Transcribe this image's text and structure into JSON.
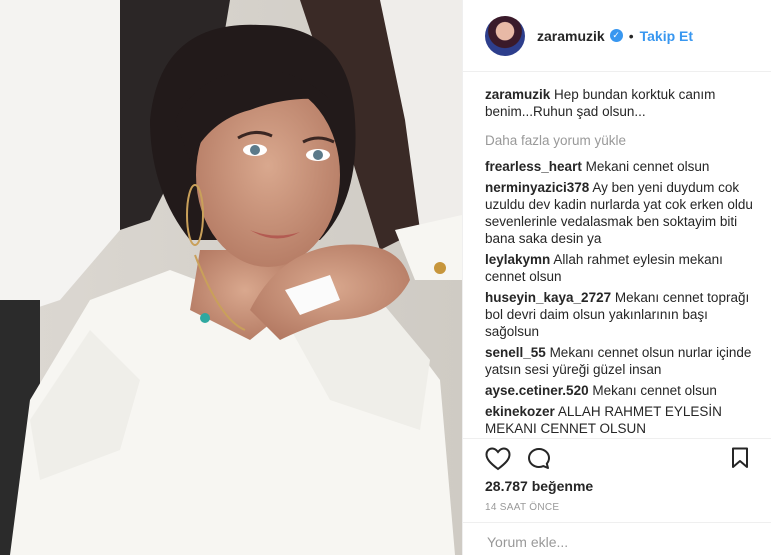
{
  "post": {
    "username": "zaramuzik",
    "verified_mark": "✓",
    "separator": "•",
    "follow_label": "Takip Et",
    "caption": "Hep bundan korktuk canım benim...Ruhun şad olsun...",
    "load_more_label": "Daha fazla yorum yükle",
    "comments": [
      {
        "user": "frearless_heart",
        "text": "Mekani cennet olsun"
      },
      {
        "user": "nerminyazici378",
        "text": "Ay ben yeni duydum cok uzuldu dev kadin nurlarda yat cok erken oldu sevenlerinle vedalasmak ben soktayim biti bana saka desin ya"
      },
      {
        "user": "leylakymn",
        "text": "Allah rahmet eylesin mekanı cennet olsun"
      },
      {
        "user": "huseyin_kaya_2727",
        "text": "Mekanı cennet toprağı bol devri daim olsun yakınlarının başı sağolsun"
      },
      {
        "user": "senell_55",
        "text": "Mekanı cennet olsun nurlar içinde yatsın sesi yüreği güzel insan"
      },
      {
        "user": "ayse.cetiner.520",
        "text": "Mekanı cennet olsun"
      },
      {
        "user": "ekinekozer",
        "text": "ALLAH RAHMET EYLESİN MEKANI CENNET OLSUN"
      }
    ],
    "likes": "28.787 beğenme",
    "time_ago": "14 SAAT ÖNCE",
    "comment_placeholder": "Yorum ekle..."
  },
  "icons": {
    "like": "heart-icon",
    "comment": "comment-icon",
    "save": "bookmark-icon"
  },
  "colors": {
    "accent": "#3897f0",
    "muted": "#999999",
    "text": "#262626"
  }
}
